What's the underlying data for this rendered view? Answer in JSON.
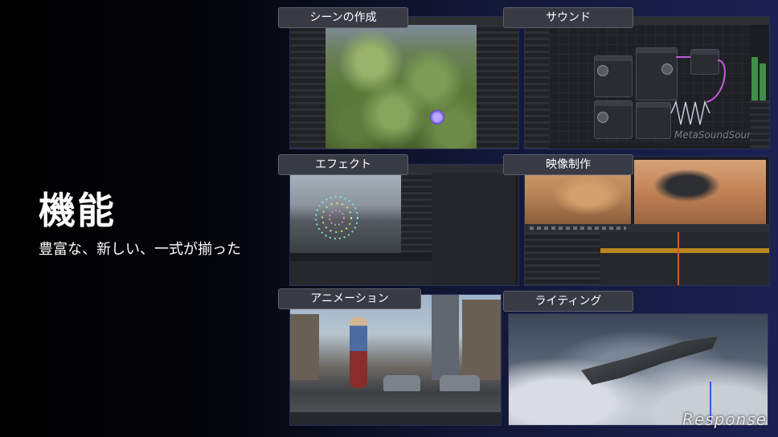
{
  "heading": "機能",
  "subtitle": "豊富な、新しい、一式が揃った",
  "panels": {
    "scene": {
      "label": "シーンの作成"
    },
    "sound": {
      "label": "サウンド",
      "watermark": "MetaSoundSource"
    },
    "effect": {
      "label": "エフェクト"
    },
    "video": {
      "label": "映像制作"
    },
    "animation": {
      "label": "アニメーション"
    },
    "lighting": {
      "label": "ライティング"
    }
  },
  "logo": {
    "text": "Response"
  }
}
